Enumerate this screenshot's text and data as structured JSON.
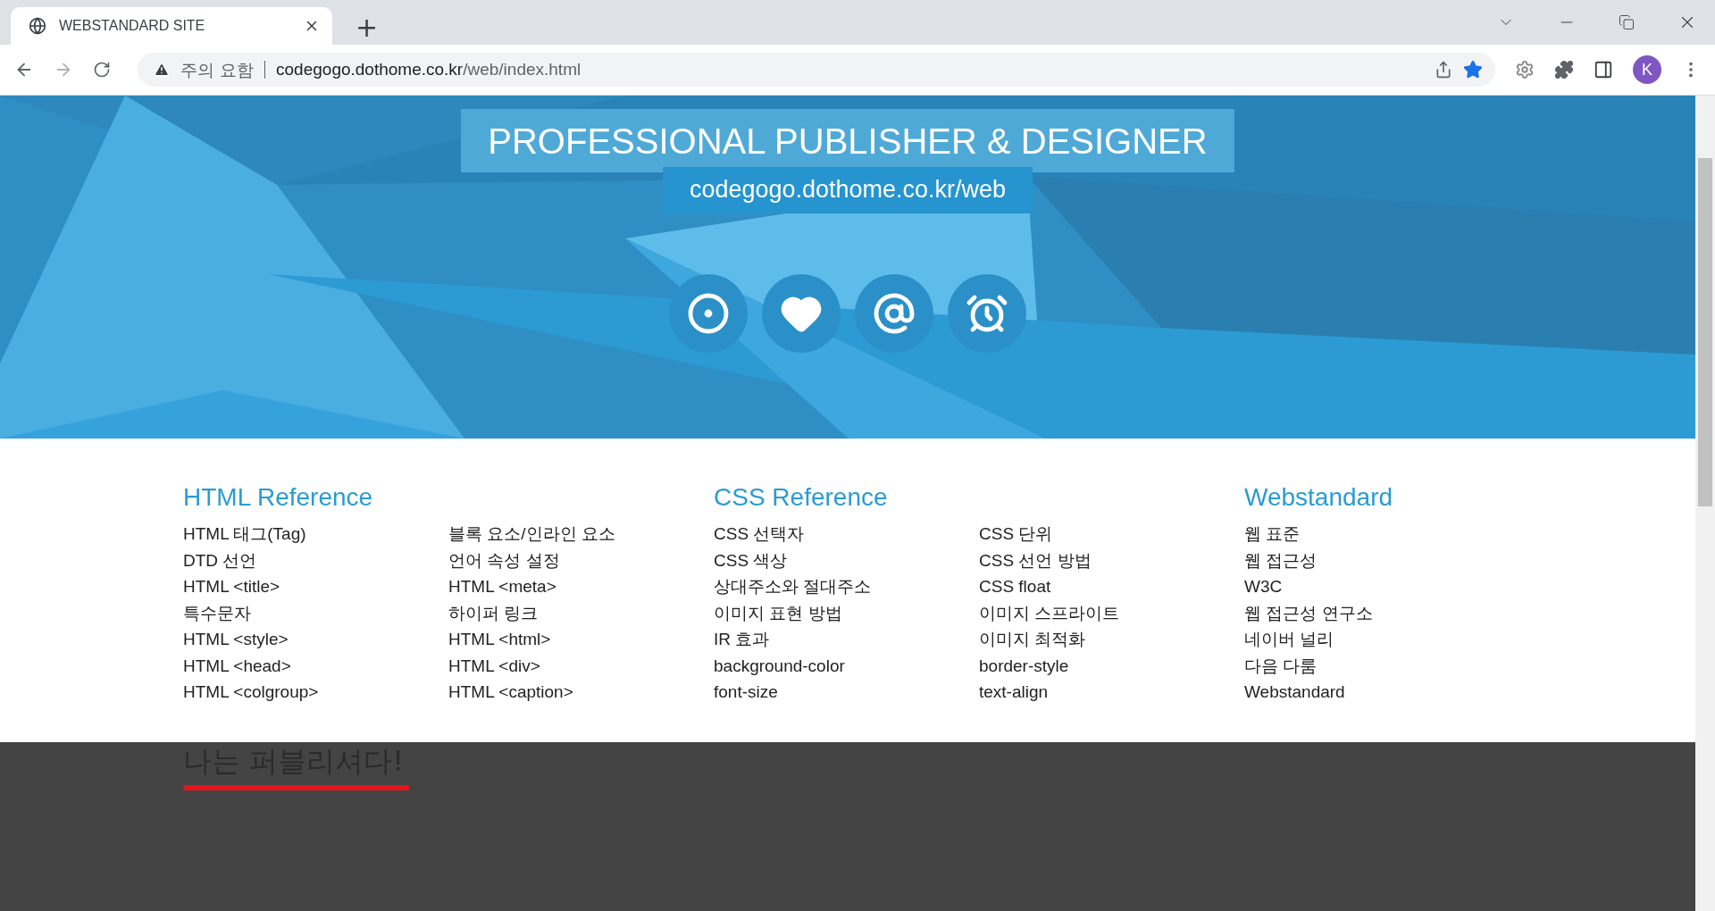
{
  "browser": {
    "tabs": [
      {
        "title": "WEBSTANDARD SITE",
        "selected": true
      }
    ],
    "new_tab": "+",
    "address": {
      "warning": "주의 요함",
      "host": "codegogo.dothome.co.kr",
      "path": "/web/index.html"
    },
    "bookmarked": true,
    "profile": "K"
  },
  "header": {
    "title": "PROFESSIONAL PUBLISHER & DESIGNER",
    "url": "codegogo.dothome.co.kr/web"
  },
  "references": [
    {
      "heading": "HTML Reference",
      "columns": [
        [
          "HTML 태그(Tag)",
          "DTD 선언",
          "HTML <title>",
          "특수문자",
          "HTML <style>",
          "HTML <head>",
          "HTML <colgroup>"
        ],
        [
          "블록 요소/인라인 요소",
          "언어 속성 설정",
          "HTML <meta>",
          "하이퍼 링크",
          "HTML <html>",
          "HTML <div>",
          "HTML <caption>"
        ]
      ]
    },
    {
      "heading": "CSS Reference",
      "columns": [
        [
          "CSS 선택자",
          "CSS 색상",
          "상대주소와 절대주소",
          "이미지 표현 방법",
          "IR 효과",
          "background-color",
          "font-size"
        ],
        [
          "CSS 단위",
          "CSS 선언 방법",
          "CSS float",
          "이미지 스프라이트",
          "이미지 최적화",
          "border-style",
          "text-align"
        ]
      ]
    },
    {
      "heading": "Webstandard",
      "columns": [
        [
          "웹 표준",
          "웹 접근성",
          "W3C",
          "웹 접근성 연구소",
          "네이버 널리",
          "다음 다룸",
          "Webstandard"
        ]
      ]
    }
  ],
  "footer": {
    "heading": "나는 퍼블리셔다!"
  }
}
